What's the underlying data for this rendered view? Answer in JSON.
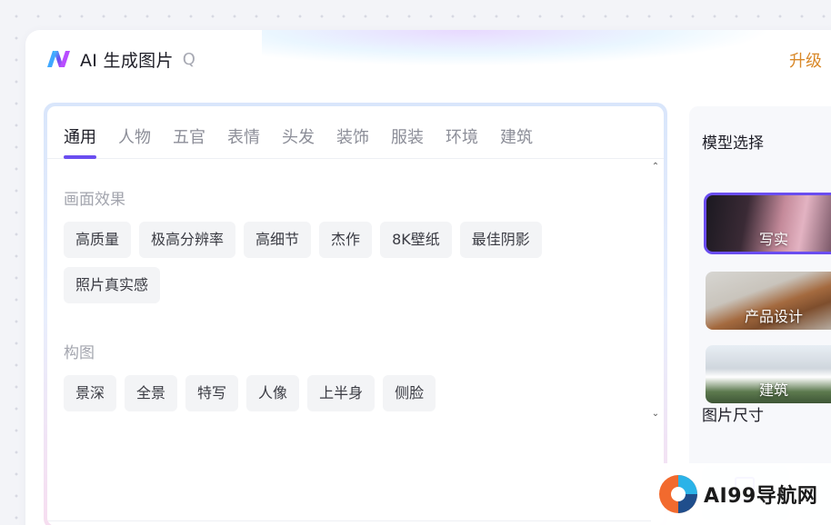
{
  "app": {
    "title": "AI 生成图片",
    "upgrade_label": "升级"
  },
  "icons": {
    "logo": "brand-logo-icon",
    "search": "search-icon"
  },
  "tabs": [
    {
      "label": "通用",
      "active": true
    },
    {
      "label": "人物"
    },
    {
      "label": "五官"
    },
    {
      "label": "表情"
    },
    {
      "label": "头发"
    },
    {
      "label": "装饰"
    },
    {
      "label": "服装"
    },
    {
      "label": "环境"
    },
    {
      "label": "建筑"
    }
  ],
  "sections": [
    {
      "title": "画面效果",
      "chips": [
        "高质量",
        "极高分辨率",
        "高细节",
        "杰作",
        "8K壁纸",
        "最佳阴影",
        "照片真实感"
      ]
    },
    {
      "title": "构图",
      "chips": [
        "景深",
        "全景",
        "特写",
        "人像",
        "上半身",
        "侧脸"
      ]
    }
  ],
  "right_panel": {
    "model_title": "模型选择",
    "models": [
      {
        "label": "写实",
        "selected": true
      },
      {
        "label": "产品设计"
      },
      {
        "label": "建筑"
      }
    ],
    "size_title": "图片尺寸"
  },
  "watermark": {
    "text": "AI99导航网"
  },
  "colors": {
    "accent": "#6a4df0",
    "upgrade": "#d9892a"
  }
}
